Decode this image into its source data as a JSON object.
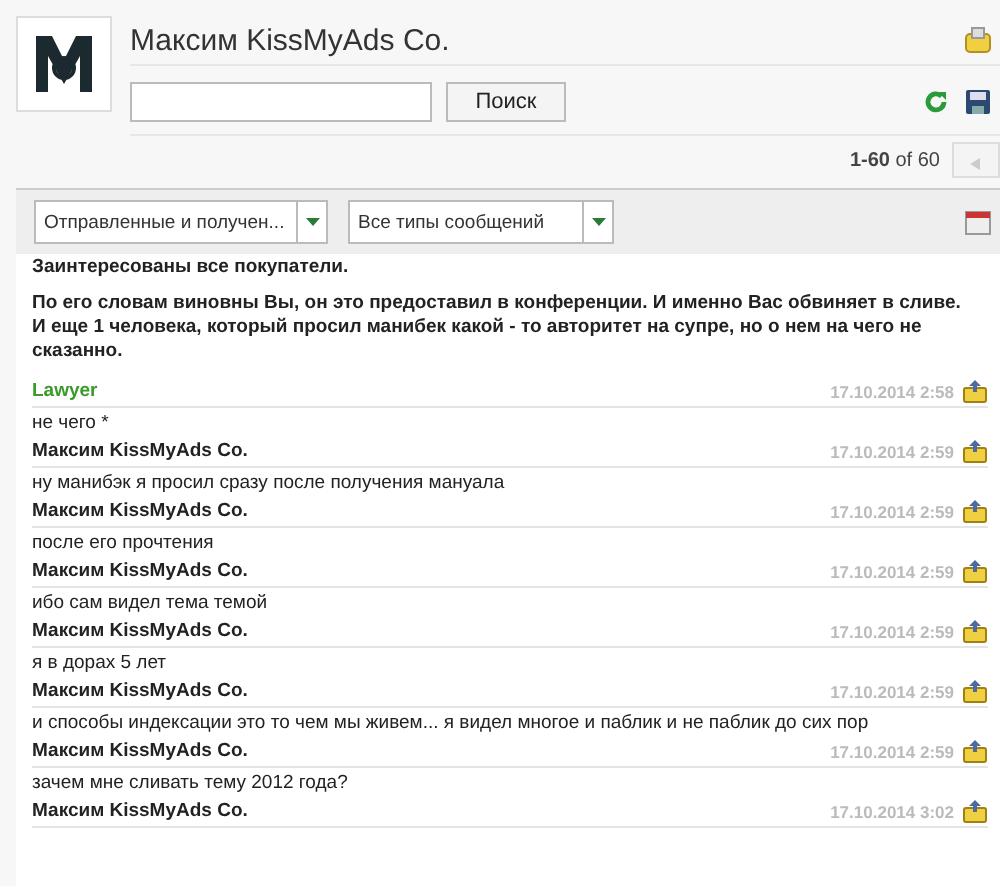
{
  "header": {
    "title": "Максим KissMyAds Co.",
    "search_button": "Поиск"
  },
  "pager": {
    "range": "1-60",
    "of": "of 60"
  },
  "filters": [
    {
      "value": "Отправленные и получен..."
    },
    {
      "value": "Все типы сообщений"
    }
  ],
  "lead_text": {
    "lines": [
      "Заинтересованы все покупатели.",
      "По его словам виновны Вы, он это предоставил в конференции. И именно Вас обвиняет в сливе. И еще 1 человека, который просил манибек какой - то авторитет на супре, но о нем на чего не сказанно."
    ]
  },
  "messages": [
    {
      "author": "Lawyer",
      "color": "#3a9a2a",
      "time": "17.10.2014 2:58",
      "text": "не чего *"
    },
    {
      "author": "Максим KissMyAds Co.",
      "color": "#222222",
      "time": "17.10.2014 2:59",
      "text": "ну манибэк я просил сразу после получения мануала"
    },
    {
      "author": "Максим KissMyAds Co.",
      "color": "#222222",
      "time": "17.10.2014 2:59",
      "text": "после его прочтения"
    },
    {
      "author": "Максим KissMyAds Co.",
      "color": "#222222",
      "time": "17.10.2014 2:59",
      "text": "ибо сам видел тема темой"
    },
    {
      "author": "Максим KissMyAds Co.",
      "color": "#222222",
      "time": "17.10.2014 2:59",
      "text": "я в дорах 5 лет"
    },
    {
      "author": "Максим KissMyAds Co.",
      "color": "#222222",
      "time": "17.10.2014 2:59",
      "text": "и способы индексации это то чем мы живем... я видел многое и паблик и не паблик до сих пор"
    },
    {
      "author": "Максим KissMyAds Co.",
      "color": "#222222",
      "time": "17.10.2014 2:59",
      "text": "зачем мне сливать тему 2012 года?"
    },
    {
      "author": "Максим KissMyAds Co.",
      "color": "#222222",
      "time": "17.10.2014 3:02"
    }
  ]
}
